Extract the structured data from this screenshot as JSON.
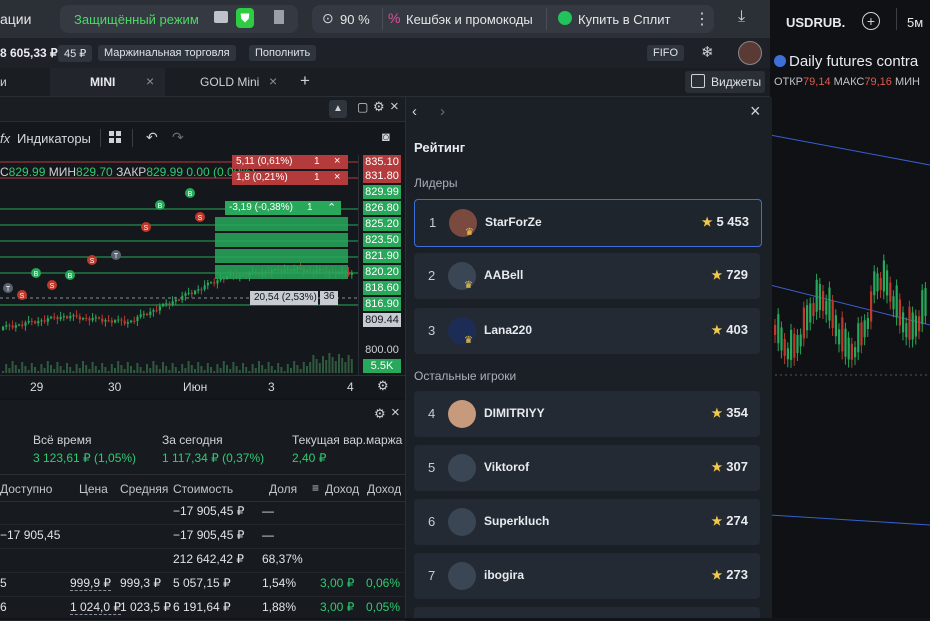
{
  "browser": {
    "title_partial": "ации",
    "protected_mode": "Защищённый режим",
    "zoom": "90 %",
    "cashback": "Кешбэк и промокоды",
    "split": "Купить в Сплит"
  },
  "right_chart": {
    "ticker": "USDRUB.",
    "timeframe": "5м",
    "title": "Daily futures contra",
    "otkr_label": "ОТКР",
    "otkr_value": "79,14",
    "maks_label": "МАКС",
    "maks_value": "79,16",
    "min_label": "МИН"
  },
  "appbar": {
    "balance": "8 605,33 ₽",
    "balance_badge": "45 ₽",
    "margin_trading": "Маржинальная торговля",
    "top_up": "Пополнить",
    "fifo": "FIFO"
  },
  "tabs": {
    "left_partial": "и",
    "mini": "MINI",
    "gold_mini": "GOLD Mini",
    "add": "+",
    "widgets": "Виджеты"
  },
  "chart": {
    "indicators": "Индикаторы",
    "ohlc_prefix": "С",
    "ohlc_first": "829.99",
    "min_label": "МИН",
    "min_value": "829.70",
    "close_label": "ЗАКР",
    "close_value": "829.99",
    "change": "0.00 (0.00%)",
    "price_levels": [
      "835.10",
      "831.80",
      "829.99",
      "826.80",
      "825.20",
      "823.50",
      "821.90",
      "820.20",
      "818.60",
      "816.90",
      "809.44",
      "800.00",
      "5.5K"
    ],
    "x_labels": [
      "29",
      "30",
      "Июн",
      "3",
      "4"
    ],
    "orders_top": [
      {
        "text": "5,11 (0,61%)",
        "qty": "1"
      },
      {
        "text": "1,8 (0,21%)",
        "qty": "1"
      }
    ],
    "orders_mid": [
      {
        "text": "-3,19 (-0,38%)",
        "qty": "1"
      }
    ],
    "position_label": "20,54 (2,53%)",
    "position_qty": "36",
    "markers": [
      "B",
      "S",
      "T"
    ]
  },
  "summary": {
    "all_time_label": "Всё время",
    "all_time_value": "3 123,61 ₽ (1,05%)",
    "today_label": "За сегодня",
    "today_value": "1 117,34 ₽ (0,37%)",
    "margin_label": "Текущая вар.маржа",
    "margin_value": "2,40 ₽"
  },
  "table": {
    "headers": [
      "Доступно",
      "Цена",
      "Средняя",
      "Стоимость",
      "Доля",
      "Доход",
      "Доход"
    ],
    "rows": [
      {
        "available": "",
        "price": "",
        "avg": "",
        "cost": "−17 905,45 ₽",
        "share": "—",
        "income": "",
        "income_pct": ""
      },
      {
        "available": "−17 905,45",
        "price": "",
        "avg": "",
        "cost": "−17 905,45 ₽",
        "share": "—",
        "income": "",
        "income_pct": ""
      },
      {
        "available": "",
        "price": "",
        "avg": "",
        "cost": "212 642,42 ₽",
        "share": "68,37%",
        "income": "",
        "income_pct": ""
      },
      {
        "available": "5",
        "price": "999,9 ₽",
        "avg": "999,3 ₽",
        "cost": "5 057,15 ₽",
        "share": "1,54%",
        "income": "3,00 ₽",
        "income_pct": "0,06%"
      },
      {
        "available": "6",
        "price": "1 024,0 ₽",
        "avg": "1 023,5 ₽",
        "cost": "6 191,64 ₽",
        "share": "1,88%",
        "income": "3,00 ₽",
        "income_pct": "0,05%"
      }
    ]
  },
  "rating": {
    "title": "Рейтинг",
    "leaders_label": "Лидеры",
    "others_label": "Остальные игроки",
    "leaders": [
      {
        "rank": "1",
        "name": "StarForZe",
        "score": "5 453"
      },
      {
        "rank": "2",
        "name": "AABell",
        "score": "729"
      },
      {
        "rank": "3",
        "name": "Lana220",
        "score": "403"
      }
    ],
    "others": [
      {
        "rank": "4",
        "name": "DIMITRIYY",
        "score": "354"
      },
      {
        "rank": "5",
        "name": "Viktorof",
        "score": "307"
      },
      {
        "rank": "6",
        "name": "Superkluch",
        "score": "274"
      },
      {
        "rank": "7",
        "name": "ibogira",
        "score": "273"
      }
    ]
  },
  "colors": {
    "accent": "#3e6fd8",
    "green": "#2ecc71",
    "red": "#c0392b",
    "panel": "#1b2027"
  }
}
